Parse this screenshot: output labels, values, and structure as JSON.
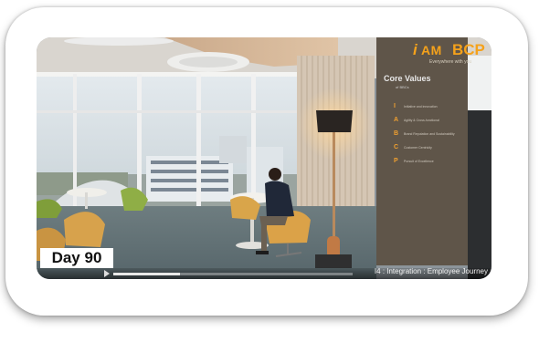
{
  "video": {
    "day_label": "Day 90",
    "chapter_title": "I4 : Integration : Employee Journey",
    "progress": 0.28,
    "brand": {
      "i": "i",
      "am": "AM",
      "bcp": "BCP",
      "tagline": "Everywhere with you"
    },
    "core_values": {
      "title": "Core Values",
      "subtitle": "of BBCs",
      "items": [
        {
          "letter": "I",
          "text": "Initiative and innovation"
        },
        {
          "letter": "A",
          "text": "Agility & Cross-functional"
        },
        {
          "letter": "B",
          "text": "Brand Reputation and Sustainability"
        },
        {
          "letter": "C",
          "text": "Customer Centricity"
        },
        {
          "letter": "P",
          "text": "Pursuit of Excellence"
        }
      ]
    }
  }
}
